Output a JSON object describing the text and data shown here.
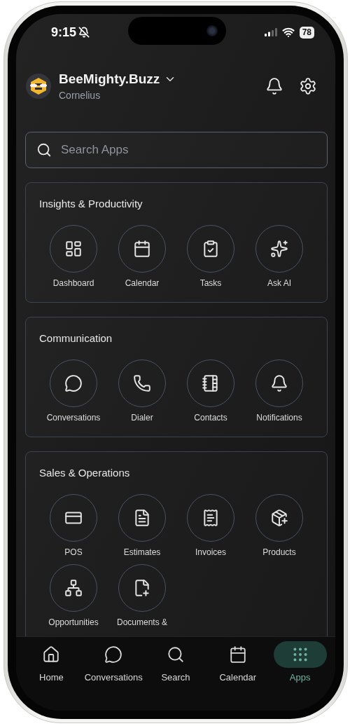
{
  "status_bar": {
    "time": "9:15",
    "battery": "78"
  },
  "header": {
    "title": "BeeMighty.Buzz",
    "subtitle": "Cornelius"
  },
  "search": {
    "placeholder": "Search Apps"
  },
  "sections": [
    {
      "title": "Insights & Productivity",
      "apps": [
        {
          "label": "Dashboard"
        },
        {
          "label": "Calendar"
        },
        {
          "label": "Tasks"
        },
        {
          "label": "Ask AI"
        }
      ]
    },
    {
      "title": "Communication",
      "apps": [
        {
          "label": "Conversations"
        },
        {
          "label": "Dialer"
        },
        {
          "label": "Contacts"
        },
        {
          "label": "Notifications"
        }
      ]
    },
    {
      "title": "Sales & Operations",
      "apps": [
        {
          "label": "POS"
        },
        {
          "label": "Estimates"
        },
        {
          "label": "Invoices"
        },
        {
          "label": "Products"
        },
        {
          "label": "Opportunities"
        },
        {
          "label": "Documents &"
        }
      ]
    }
  ],
  "tab_bar": [
    {
      "label": "Home",
      "selected": false
    },
    {
      "label": "Conversations",
      "selected": false
    },
    {
      "label": "Search",
      "selected": false
    },
    {
      "label": "Calendar",
      "selected": false
    },
    {
      "label": "Apps",
      "selected": true
    }
  ]
}
